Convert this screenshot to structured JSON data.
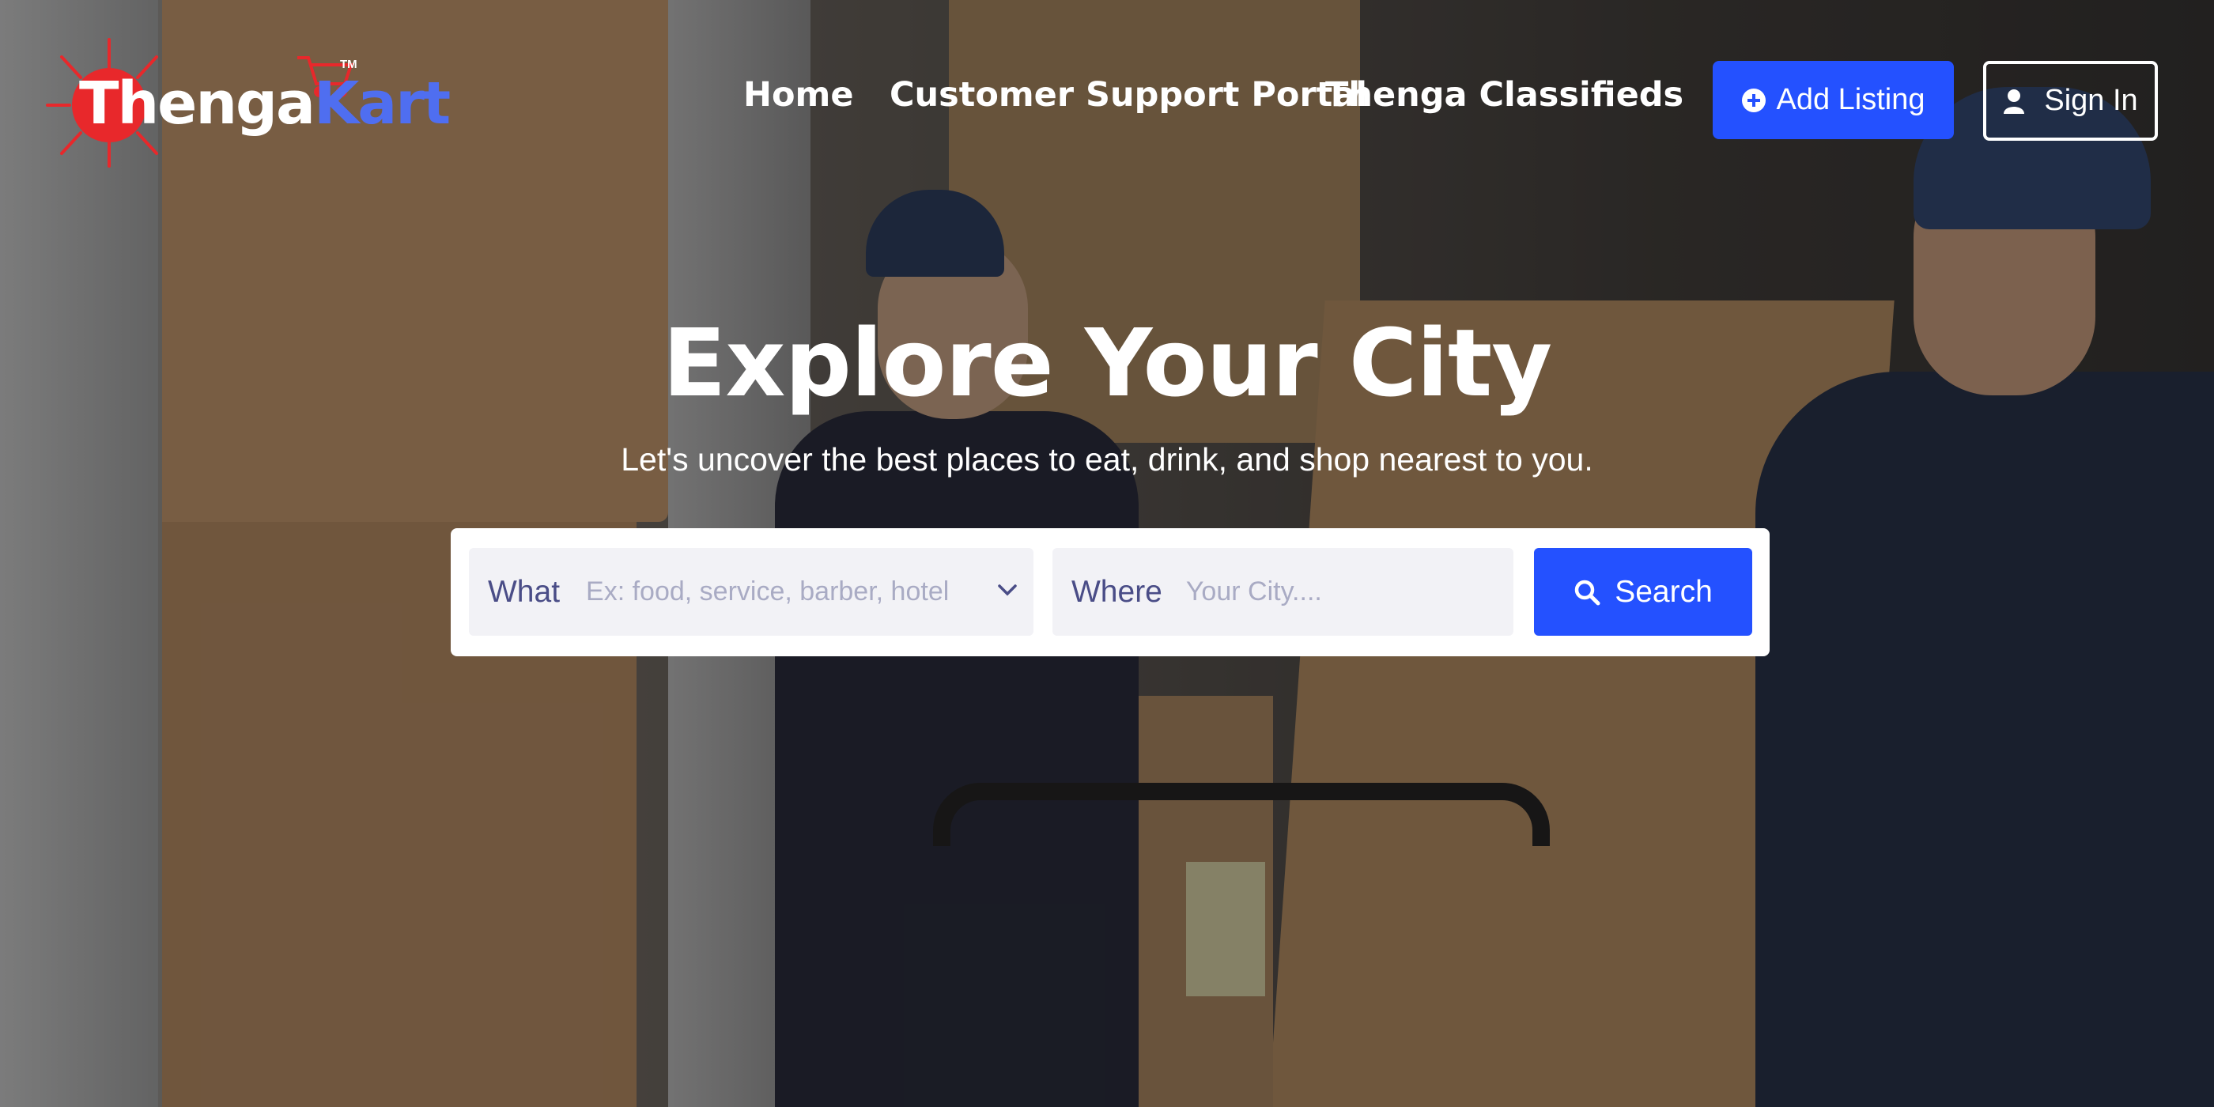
{
  "brand": {
    "logo_part1": "Thenga",
    "logo_part2": "Kart",
    "tm": "TM"
  },
  "nav": {
    "home": "Home",
    "support": "Customer Support Portal",
    "classifieds": "Thenga Classifieds"
  },
  "actions": {
    "add_listing": "Add Listing",
    "sign_in": "Sign In"
  },
  "hero": {
    "title": "Explore Your City",
    "subtitle": "Let's uncover the best places to eat, drink, and shop nearest to you."
  },
  "search": {
    "what_label": "What",
    "what_placeholder": "Ex: food, service, barber, hotel",
    "where_label": "Where",
    "where_placeholder": "Your City....",
    "button": "Search"
  },
  "colors": {
    "accent": "#2451ff",
    "logo_red": "#e8282b",
    "logo_blue": "#4f6ef0"
  },
  "icons": [
    "sun-logo-icon",
    "shopping-cart-icon",
    "plus-circle-icon",
    "user-icon",
    "chevron-down-icon",
    "location-crosshair-icon",
    "search-icon"
  ]
}
